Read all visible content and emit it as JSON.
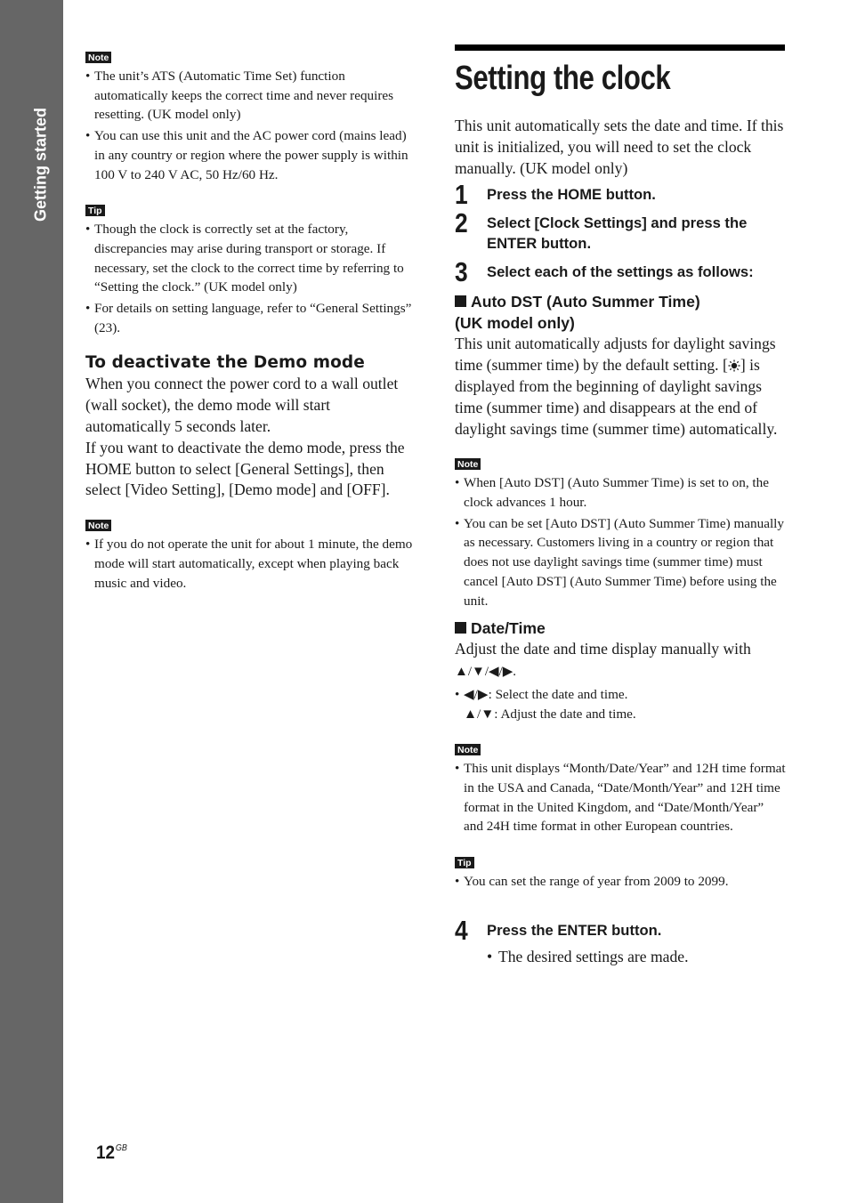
{
  "sidebar": {
    "section_label": "Getting started"
  },
  "left": {
    "note1": {
      "badge": "Note",
      "items": [
        "The unit’s ATS (Automatic Time Set) function automatically keeps the correct time and never requires resetting. (UK model only)",
        "You can use this unit and the AC power cord (mains lead) in any country or region where the power supply is within 100 V to 240 V AC, 50 Hz/60 Hz."
      ]
    },
    "tip1": {
      "badge": "Tip",
      "items": [
        "Though the clock is correctly set at the factory, discrepancies may arise during transport or storage. If necessary, set the clock to the correct time by referring to “Setting the clock.” (UK model only)",
        "For details on setting language, refer to “General Settings” (23)."
      ]
    },
    "demo": {
      "heading": "To deactivate the Demo mode",
      "para1": "When you connect the power cord to a wall outlet (wall socket), the demo mode will start automatically 5 seconds later.",
      "para2": "If you want to deactivate the demo mode, press the HOME button to select [General Settings], then select [Video Setting], [Demo mode] and [OFF]."
    },
    "note2": {
      "badge": "Note",
      "items": [
        "If you do not operate the unit for about 1 minute, the demo mode will start automatically, except when playing back music and video."
      ]
    }
  },
  "right": {
    "title": "Setting the clock",
    "intro": "This unit automatically sets the date and time. If this unit is initialized, you will need to set the clock manually. (UK model only)",
    "steps": [
      {
        "num": "1",
        "text": "Press the HOME button."
      },
      {
        "num": "2",
        "text": "Select [Clock Settings] and press the ENTER button."
      },
      {
        "num": "3",
        "text": "Select each of the settings as follows:"
      },
      {
        "num": "4",
        "text": "Press the ENTER button."
      }
    ],
    "auto_dst": {
      "heading_line1": "Auto DST (Auto Summer Time)",
      "heading_line2": "(UK model only)",
      "para_before_icon": "This unit automatically adjusts for daylight savings time (summer time) by the default setting. [",
      "icon": "summer-time-sun-icon",
      "para_after_icon": "] is displayed from the beginning of daylight savings time (summer time) and disappears at the end of daylight savings time (summer time) automatically."
    },
    "note_dst": {
      "badge": "Note",
      "items": [
        "When [Auto DST] (Auto Summer Time) is set to on, the clock advances 1 hour.",
        "You can be set [Auto DST] (Auto Summer Time) manually as necessary. Customers living in a country or region that does not use daylight savings time (summer time) must cancel [Auto DST] (Auto Summer Time) before using the unit."
      ]
    },
    "date_time": {
      "heading": "Date/Time",
      "para": "Adjust the date and time display manually with",
      "arrows": "▲/▼/◀/▶.",
      "bullet_line1": "◀/▶: Select the date and time.",
      "bullet_line2": "▲/▼: Adjust the date and time."
    },
    "note_format": {
      "badge": "Note",
      "items": [
        "This unit displays “Month/Date/Year” and 12H time format in the USA and Canada, “Date/Month/Year” and 12H time format in the United Kingdom, and “Date/Month/Year” and 24H time format in other European countries."
      ]
    },
    "tip_year": {
      "badge": "Tip",
      "items": [
        "You can set the range of year from 2009 to 2099."
      ]
    },
    "step4_result": "The desired settings are made."
  },
  "footer": {
    "page_number": "12",
    "page_suffix": "GB"
  }
}
